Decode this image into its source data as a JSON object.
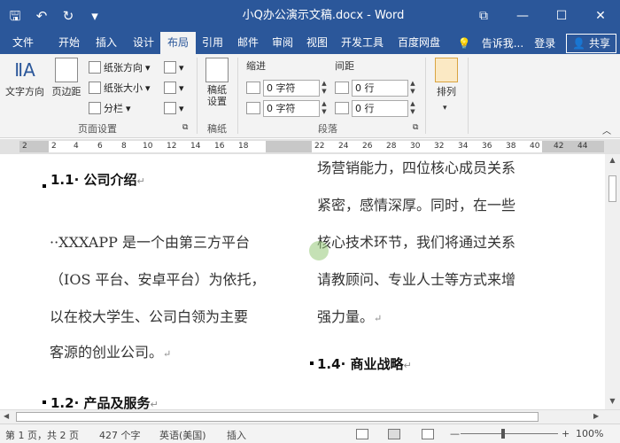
{
  "window": {
    "title": "小Q办公演示文稿.docx - Word",
    "qat": {
      "save": "🖫",
      "undo": "↶",
      "redo": "↻",
      "customize": "▾"
    },
    "controls": {
      "ribbon_options": "⧉",
      "minimize": "—",
      "maximize": "☐",
      "close": "✕"
    }
  },
  "tabs": [
    {
      "label": "文件",
      "active": false
    },
    {
      "label": "开始",
      "active": false
    },
    {
      "label": "插入",
      "active": false
    },
    {
      "label": "设计",
      "active": false
    },
    {
      "label": "布局",
      "active": true
    },
    {
      "label": "引用",
      "active": false
    },
    {
      "label": "邮件",
      "active": false
    },
    {
      "label": "审阅",
      "active": false
    },
    {
      "label": "视图",
      "active": false
    },
    {
      "label": "开发工具",
      "active": false
    },
    {
      "label": "百度网盘",
      "active": false
    }
  ],
  "tell_me": "告诉我...",
  "login": "登录",
  "share": "共享",
  "ribbon": {
    "page_setup": {
      "label": "页面设置",
      "text_direction": "文字方向",
      "margins": "页边距",
      "orientation": "纸张方向",
      "size": "纸张大小",
      "columns": "分栏"
    },
    "manuscript": {
      "label": "稿纸",
      "button": "稿纸\n设置"
    },
    "paragraph": {
      "label": "段落",
      "indent_title": "缩进",
      "spacing_title": "间距",
      "indent_left": "0 字符",
      "indent_right": "0 字符",
      "spacing_before": "0 行",
      "spacing_after": "0 行"
    },
    "arrange": {
      "label": "排列"
    }
  },
  "ruler": {
    "ticks_left": [
      "2",
      "2",
      "4",
      "6",
      "8",
      "10",
      "12",
      "14",
      "16",
      "18"
    ],
    "ticks_right": [
      "22",
      "24",
      "26",
      "28",
      "30",
      "32",
      "34",
      "36",
      "38",
      "40",
      "42",
      "44"
    ]
  },
  "document": {
    "heading_1_1": "1.1· 公司介绍",
    "para1_lines": [
      "··XXXAPP 是一个由第三方平台",
      "（IOS 平台、安卓平台）为依托，",
      "以在校大学生、公司白领为主要",
      "客源的创业公司。"
    ],
    "heading_1_2": "1.2· 产品及服务",
    "col2_lines": [
      "场营销能力，四位核心成员关系",
      "紧密，感情深厚。同时，在一些",
      "核心技术环节，我们将通过关系",
      "请教顾问、专业人士等方式来增",
      "强力量。"
    ],
    "heading_1_4": "1.4· 商业战略",
    "para_mark": "↵"
  },
  "status": {
    "page": "第 1 页，共 2 页",
    "words": "427 个字",
    "language": "英语(美国)",
    "mode": "插入",
    "zoom": "100%",
    "zoom_minus": "—",
    "zoom_plus": "+"
  }
}
